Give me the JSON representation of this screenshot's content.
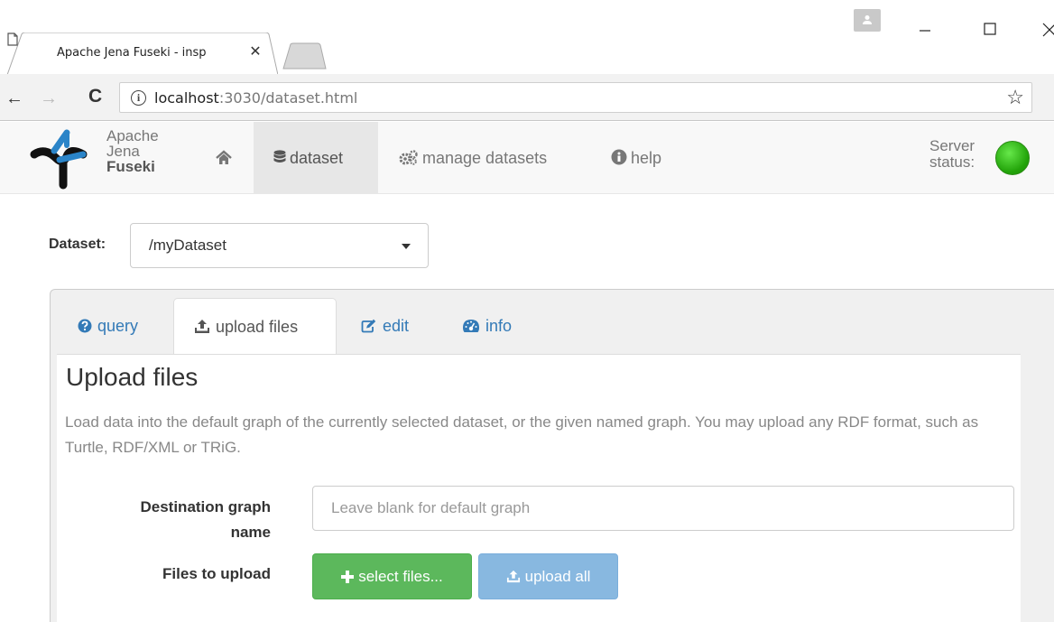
{
  "browser": {
    "tab_title": "Apache Jena Fuseki - insp",
    "tab_close_glyph": "✕",
    "url_host": "localhost",
    "url_rest": ":3030/dataset.html",
    "nav_back": "←",
    "nav_forward": "→",
    "nav_reload": "C",
    "info_glyph": "i",
    "star_glyph": "☆"
  },
  "navbar": {
    "brand_line1": "Apache",
    "brand_line2": "Jena",
    "brand_line3": "Fuseki",
    "items": [
      {
        "label": "dataset",
        "icon": "database-icon",
        "active": true
      },
      {
        "label": "manage datasets",
        "icon": "cogs-icon",
        "active": false
      },
      {
        "label": "help",
        "icon": "info-circle-icon",
        "active": false
      }
    ],
    "server_status_line1": "Server",
    "server_status_line2": "status:",
    "status_color": "#2db40f"
  },
  "dataset": {
    "label": "Dataset:",
    "selected": "/myDataset"
  },
  "tabs": [
    {
      "label": "query",
      "icon": "question-circle-icon",
      "active": false
    },
    {
      "label": "upload files",
      "icon": "upload-icon",
      "active": true
    },
    {
      "label": "edit",
      "icon": "edit-icon",
      "active": false
    },
    {
      "label": "info",
      "icon": "dashboard-icon",
      "active": false
    }
  ],
  "upload": {
    "title": "Upload files",
    "description": "Load data into the default graph of the currently selected dataset, or the given named graph. You may upload any RDF format, such as Turtle, RDF/XML or TRiG.",
    "dest_label": "Destination graph name",
    "dest_placeholder": "Leave blank for default graph",
    "files_label": "Files to upload",
    "select_button": "select files...",
    "upload_button": "upload all"
  },
  "colors": {
    "link": "#337ab7",
    "success": "#5cb85c",
    "primary_disabled": "#88b8e0"
  }
}
